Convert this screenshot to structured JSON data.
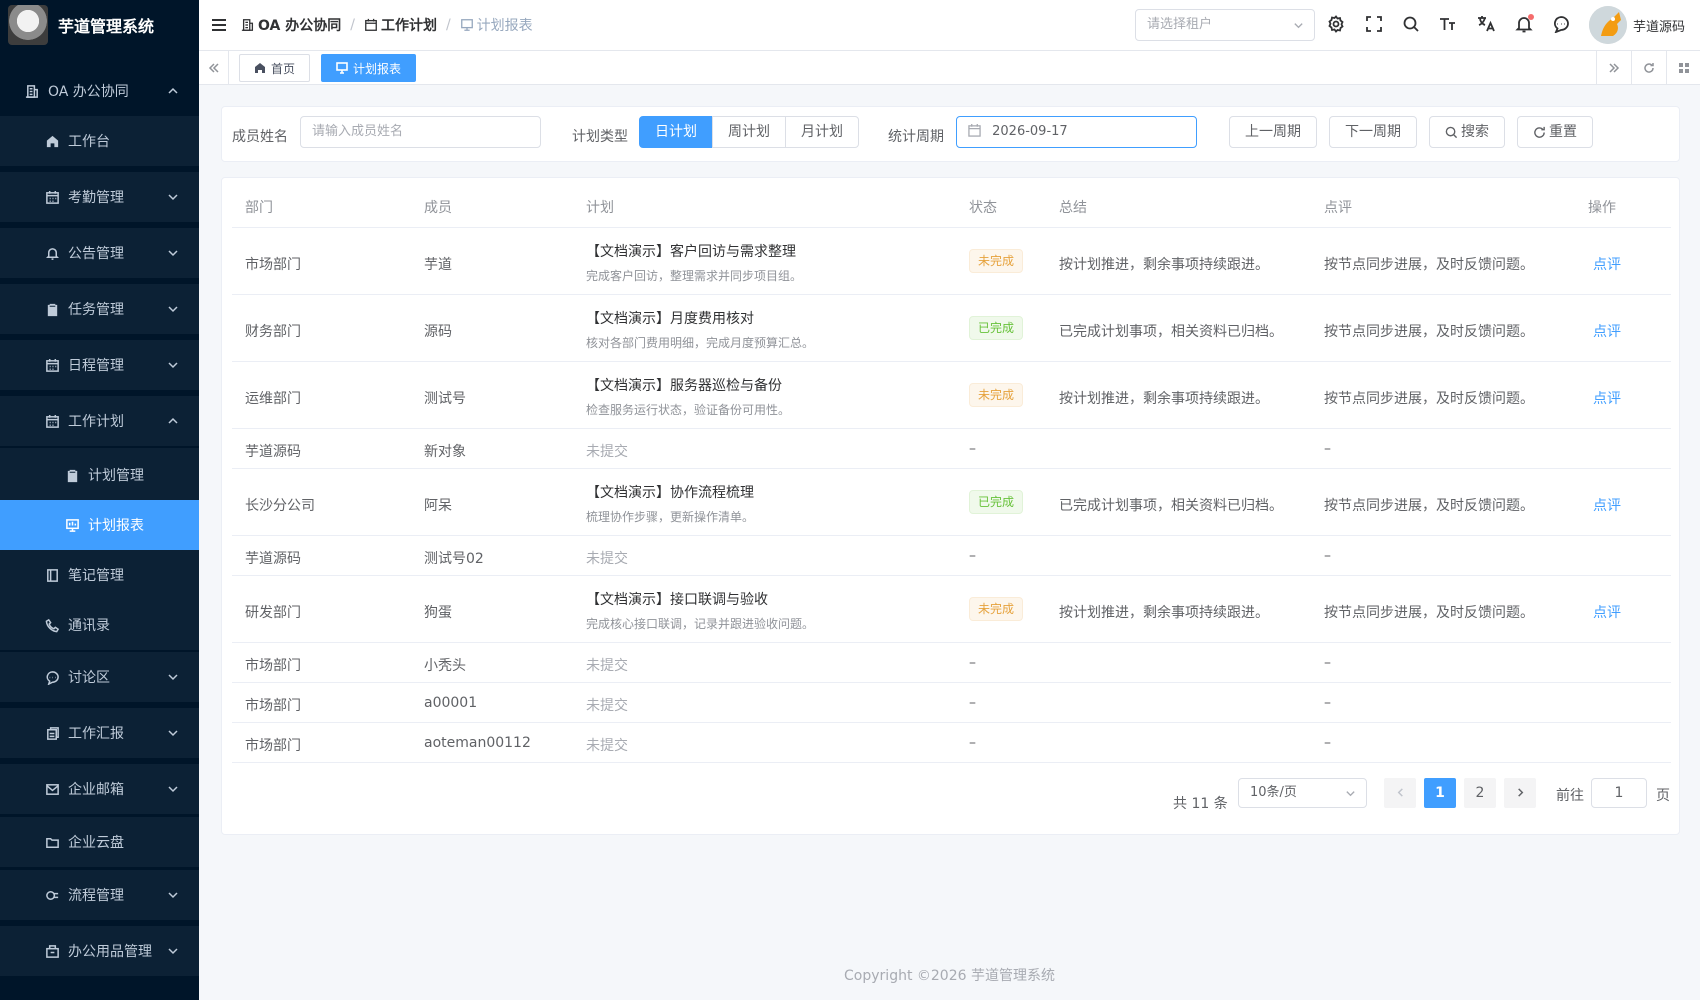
{
  "app": {
    "title": "芋道管理系统"
  },
  "sidebar": {
    "items": [
      {
        "label": "OA 办公协同",
        "icon": "building-icon",
        "expanded": true
      },
      {
        "label": "工作台",
        "icon": "home-icon"
      },
      {
        "label": "考勤管理",
        "icon": "calendar-icon"
      },
      {
        "label": "公告管理",
        "icon": "bell-icon"
      },
      {
        "label": "任务管理",
        "icon": "clipboard-check-icon"
      },
      {
        "label": "日程管理",
        "icon": "calendar-icon"
      },
      {
        "label": "工作计划",
        "icon": "calendar-icon",
        "expanded": true
      },
      {
        "label": "计划管理",
        "icon": "clipboard-icon"
      },
      {
        "label": "计划报表",
        "icon": "monitor-icon",
        "active": true
      },
      {
        "label": "笔记管理",
        "icon": "notebook-icon"
      },
      {
        "label": "通讯录",
        "icon": "phone-icon"
      },
      {
        "label": "讨论区",
        "icon": "chat-icon"
      },
      {
        "label": "工作汇报",
        "icon": "copy-icon"
      },
      {
        "label": "企业邮箱",
        "icon": "mail-icon"
      },
      {
        "label": "企业云盘",
        "icon": "folder-icon"
      },
      {
        "label": "流程管理",
        "icon": "flow-icon"
      },
      {
        "label": "办公用品管理",
        "icon": "box-icon"
      }
    ]
  },
  "header": {
    "breadcrumb": [
      "OA 办公协同",
      "工作计划",
      "计划报表"
    ],
    "tenant_placeholder": "请选择租户",
    "user_name": "芋道源码"
  },
  "tags": {
    "home": "首页",
    "current": "计划报表"
  },
  "search": {
    "member_label": "成员姓名",
    "member_placeholder": "请输入成员姓名",
    "type_label": "计划类型",
    "types": [
      "日计划",
      "周计划",
      "月计划"
    ],
    "selected_type": "日计划",
    "period_label": "统计周期",
    "period_value": "2026-09-17",
    "prev_label": "上一周期",
    "next_label": "下一周期",
    "search_label": "搜索",
    "reset_label": "重置"
  },
  "table": {
    "columns": [
      "部门",
      "成员",
      "计划",
      "状态",
      "总结",
      "点评",
      "操作"
    ],
    "rows": [
      {
        "dept": "市场部门",
        "member": "芋道",
        "plan_title": "【文档演示】客户回访与需求整理",
        "plan_desc": "完成客户回访，整理需求并同步项目组。",
        "status": "未完成",
        "summary": "按计划推进，剩余事项持续跟进。",
        "review": "按节点同步进展，及时反馈问题。",
        "action": "点评"
      },
      {
        "dept": "财务部门",
        "member": "源码",
        "plan_title": "【文档演示】月度费用核对",
        "plan_desc": "核对各部门费用明细，完成月度预算汇总。",
        "status": "已完成",
        "summary": "已完成计划事项，相关资料已归档。",
        "review": "按节点同步进展，及时反馈问题。",
        "action": "点评"
      },
      {
        "dept": "运维部门",
        "member": "测试号",
        "plan_title": "【文档演示】服务器巡检与备份",
        "plan_desc": "检查服务运行状态，验证备份可用性。",
        "status": "未完成",
        "summary": "按计划推进，剩余事项持续跟进。",
        "review": "按节点同步进展，及时反馈问题。",
        "action": "点评"
      },
      {
        "dept": "芋道源码",
        "member": "新对象",
        "plan_title": "未提交",
        "status": "–",
        "review": "–"
      },
      {
        "dept": "长沙分公司",
        "member": "阿呆",
        "plan_title": "【文档演示】协作流程梳理",
        "plan_desc": "梳理协作步骤，更新操作清单。",
        "status": "已完成",
        "summary": "已完成计划事项，相关资料已归档。",
        "review": "按节点同步进展，及时反馈问题。",
        "action": "点评"
      },
      {
        "dept": "芋道源码",
        "member": "测试号02",
        "plan_title": "未提交",
        "status": "–",
        "review": "–"
      },
      {
        "dept": "研发部门",
        "member": "狗蛋",
        "plan_title": "【文档演示】接口联调与验收",
        "plan_desc": "完成核心接口联调，记录并跟进验收问题。",
        "status": "未完成",
        "summary": "按计划推进，剩余事项持续跟进。",
        "review": "按节点同步进展，及时反馈问题。",
        "action": "点评"
      },
      {
        "dept": "市场部门",
        "member": "小秃头",
        "plan_title": "未提交",
        "status": "–",
        "review": "–"
      },
      {
        "dept": "市场部门",
        "member": "a00001",
        "plan_title": "未提交",
        "status": "–",
        "review": "–"
      },
      {
        "dept": "市场部门",
        "member": "aoteman00112",
        "plan_title": "未提交",
        "status": "–",
        "review": "–"
      }
    ]
  },
  "pagination": {
    "total_text": "共 11 条",
    "page_size": "10条/页",
    "pages": [
      "1",
      "2"
    ],
    "current_page": "1",
    "goto_label": "前往",
    "goto_value": "1",
    "goto_suffix": "页"
  },
  "footer": {
    "copyright": "Copyright ©2026 芋道管理系统"
  },
  "colors": {
    "primary": "#409eff",
    "sidebar_bg": "#001529",
    "warning": "#e6a23c",
    "success": "#67c23a"
  }
}
